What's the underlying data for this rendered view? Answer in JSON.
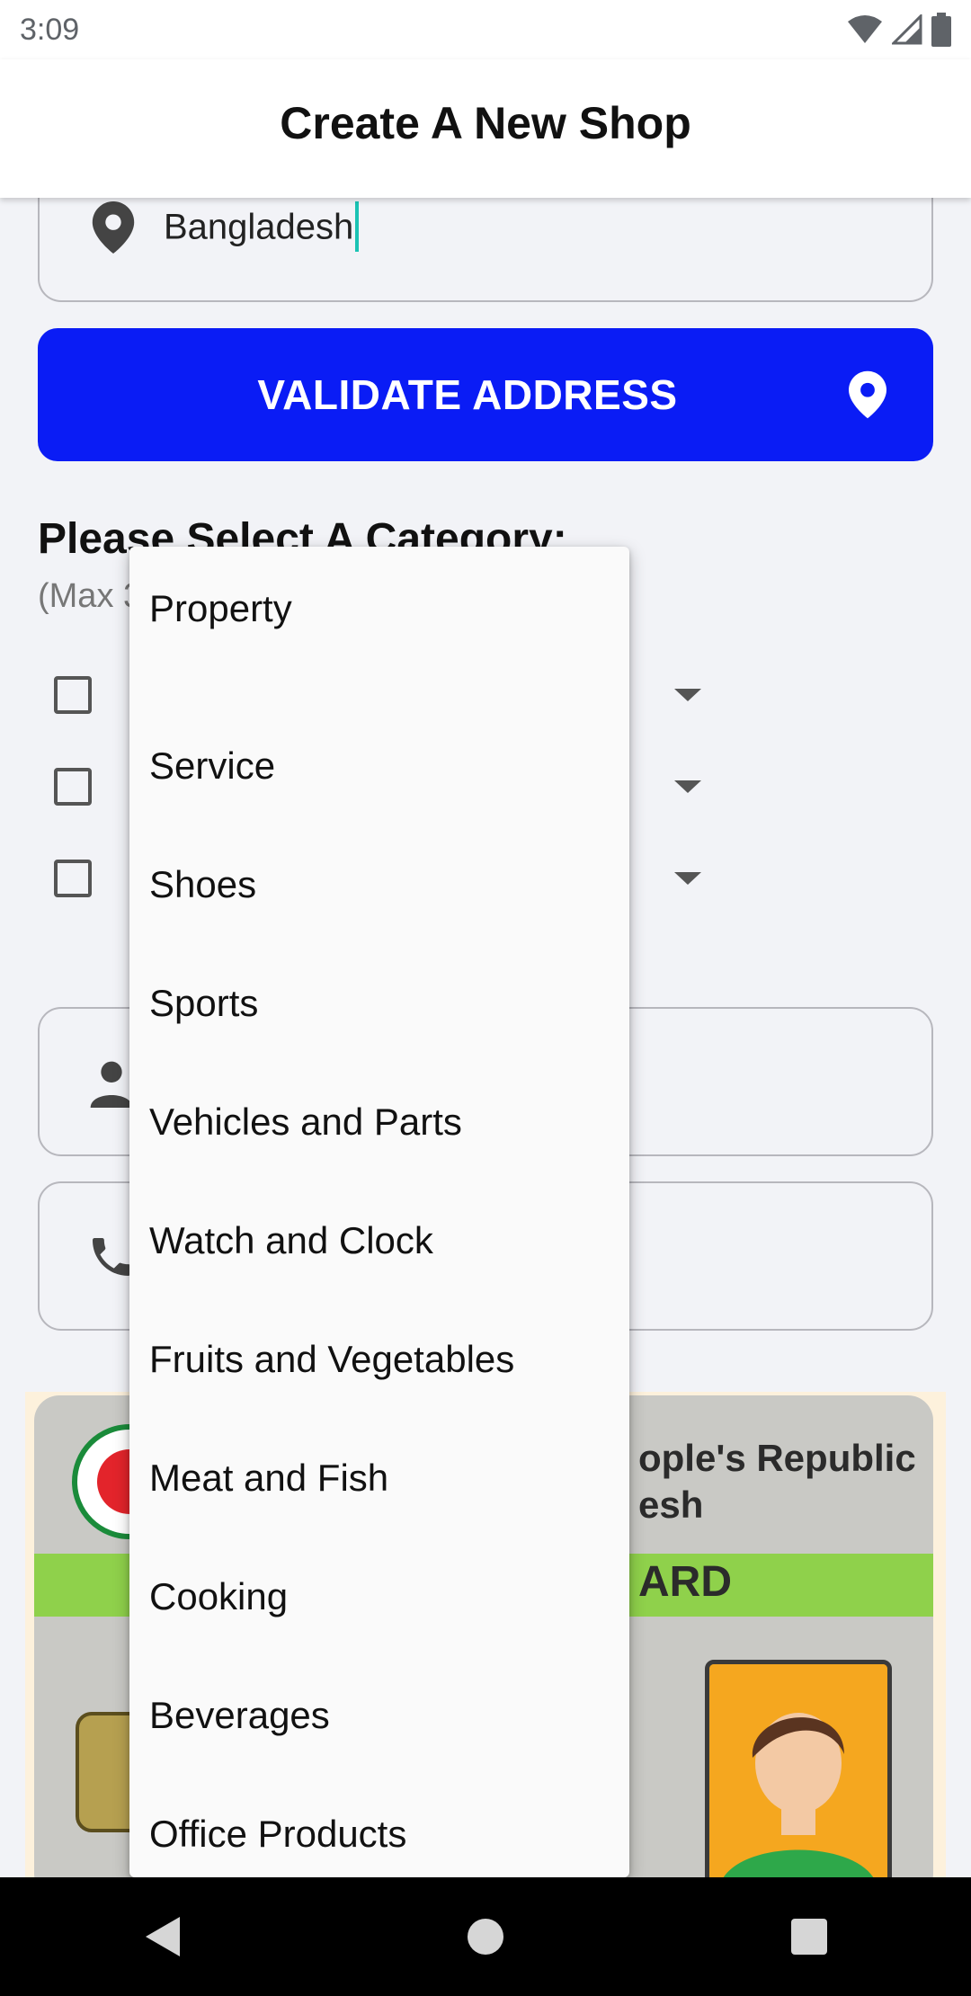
{
  "status_bar": {
    "time": "3:09"
  },
  "app_bar": {
    "title": "Create A New Shop"
  },
  "address_field": {
    "value": "Bangladesh",
    "icon": "location-pin-icon"
  },
  "validate_button": {
    "label": "VALIDATE ADDRESS",
    "icon": "location-pin-icon",
    "color": "#0a1cf5"
  },
  "category": {
    "heading": "Please Select A Category:",
    "subtext": "(Max 3"
  },
  "fields": [
    {
      "icon": "person-icon"
    },
    {
      "icon": "phone-icon"
    }
  ],
  "id_card": {
    "title_line1": "ople's Republic",
    "title_line2": "esh",
    "band_text": "ARD"
  },
  "dropdown": {
    "items": [
      "Property",
      "Service",
      "Shoes",
      "Sports",
      "Vehicles and Parts",
      "Watch and Clock",
      "Fruits and Vegetables",
      "Meat and Fish",
      "Cooking",
      "Beverages",
      "Office Products"
    ]
  },
  "nav_bar": {
    "back": "back-icon",
    "home": "home-icon",
    "recents": "recents-icon"
  }
}
